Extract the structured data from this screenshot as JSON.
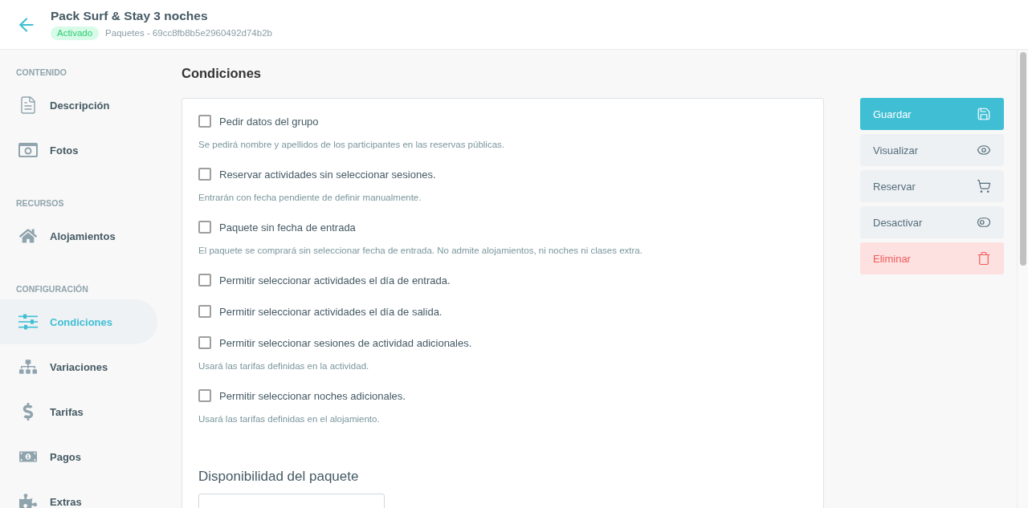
{
  "header": {
    "title": "Pack Surf & Stay 3 noches",
    "status": {
      "label": "Activado",
      "active": true
    },
    "breadcrumb": "Paquetes - 69cc8fb8b5e2960492d74b2b"
  },
  "sidebar": {
    "sections": [
      {
        "title": "CONTENIDO",
        "items": [
          {
            "label": "Descripción",
            "selected": false
          },
          {
            "label": "Fotos",
            "selected": false
          }
        ]
      },
      {
        "title": "RECURSOS",
        "items": [
          {
            "label": "Alojamientos",
            "selected": false
          }
        ]
      },
      {
        "title": "CONFIGURACIÓN",
        "items": [
          {
            "label": "Condiciones",
            "selected": true
          },
          {
            "label": "Variaciones",
            "selected": false
          },
          {
            "label": "Tarifas",
            "selected": false
          },
          {
            "label": "Pagos",
            "selected": false
          },
          {
            "label": "Extras",
            "selected": false
          }
        ]
      }
    ]
  },
  "page_title": "Condiciones",
  "options": [
    {
      "label": "Pedir datos del grupo",
      "checked": false,
      "hint": "Se pedirá nombre y apellidos de los participantes en las reservas públicas."
    },
    {
      "label": "Reservar actividades sin seleccionar sesiones.",
      "checked": false,
      "hint": "Entrarán con fecha pendiente de definir manualmente."
    },
    {
      "label": "Paquete sin fecha de entrada",
      "checked": false,
      "hint": "El paquete se comprará sin seleccionar fecha de entrada. No admite alojamientos, ni noches ni clases extra."
    },
    {
      "label": "Permitir seleccionar actividades el día de entrada.",
      "checked": false
    },
    {
      "label": "Permitir seleccionar actividades el día de salida.",
      "checked": false
    },
    {
      "label": "Permitir seleccionar sesiones de actividad adicionales.",
      "checked": false,
      "hint": "Usará las tarifas definidas en la actividad."
    },
    {
      "label": "Permitir seleccionar noches adicionales.",
      "checked": false,
      "hint": "Usará las tarifas definidas en el alojamiento."
    }
  ],
  "availability": {
    "heading": "Disponibilidad del paquete"
  },
  "actions": [
    {
      "label": "Guardar",
      "kind": "primary"
    },
    {
      "label": "Visualizar",
      "kind": "default"
    },
    {
      "label": "Reservar",
      "kind": "default"
    },
    {
      "label": "Desactivar",
      "kind": "default"
    },
    {
      "label": "Eliminar",
      "kind": "danger"
    }
  ]
}
